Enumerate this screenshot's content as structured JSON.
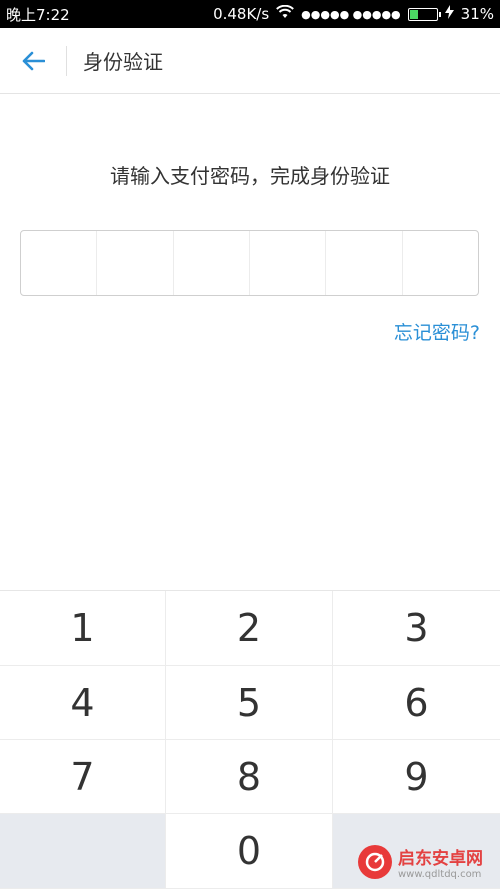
{
  "status_bar": {
    "time": "晚上7:22",
    "speed": "0.48K/s",
    "signal_dots": "●●●●● ●●●●●",
    "battery_percent": "31%",
    "battery_level": 0.31
  },
  "header": {
    "title": "身份验证"
  },
  "prompt": "请输入支付密码，完成身份验证",
  "pin_length": 6,
  "forgot_link": "忘记密码?",
  "keypad": {
    "keys": [
      "1",
      "2",
      "3",
      "4",
      "5",
      "6",
      "7",
      "8",
      "9",
      "",
      "0",
      ""
    ]
  },
  "watermark": {
    "name": "启东安卓网",
    "url": "www.qdltdq.com"
  },
  "colors": {
    "accent": "#2a8fd6",
    "keypad_gray": "#e7eaef"
  }
}
